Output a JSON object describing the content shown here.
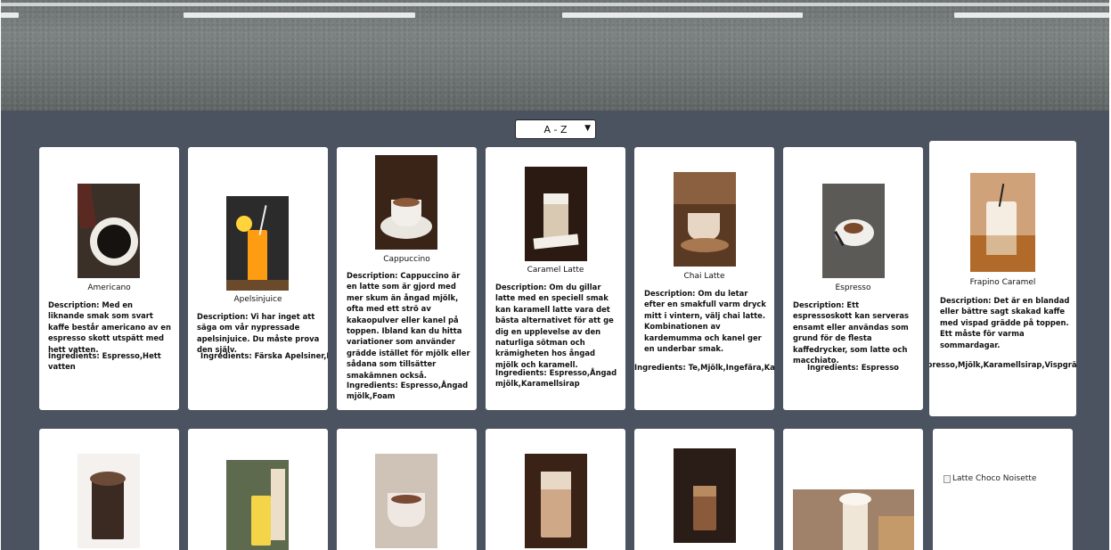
{
  "sort": {
    "selected": "A - Z"
  },
  "products_row1": [
    {
      "name": "Americano",
      "description": "Description: Med en liknande smak som svart kaffe består americano av en espresso skott utspätt med hett vatten.",
      "ingredients": "Ingredients: Espresso,Hett vatten",
      "photo_colors": [
        "#3b3028",
        "#efece6",
        "#151210"
      ]
    },
    {
      "name": "Apelsinjuice",
      "description": "Description: Vi har inget att säga om vår nypressade apelsinjuice. Du måste prova den själv.",
      "ingredients": "Ingredients: Färska Apelsiner,Is",
      "photo_colors": [
        "#2b2b2b",
        "#ff9d12",
        "#ffd43b"
      ]
    },
    {
      "name": "Cappuccino",
      "description": "Description: Cappuccino är en latte som är gjord med mer skum än ångad mjölk, ofta med ett strö av kakaopulver eller kanel på toppen. Ibland kan du hitta variationer som använder grädde istället för mjölk eller sådana som tillsätter smakämnen också.",
      "ingredients": "Ingredients: Espresso,Ångad mjölk,Foam",
      "photo_colors": [
        "#3a2418",
        "#1f1410",
        "#e9e6df"
      ]
    },
    {
      "name": "Caramel Latte",
      "description": "Description: Om du gillar latte med en speciell smak kan karamell latte vara det bästa alternativet för att ge dig en upplevelse av den naturliga sötman och krämigheten hos ångad mjölk och karamell.",
      "ingredients": "Ingredients: Espresso,Ångad mjölk,Karamellsirap",
      "photo_colors": [
        "#2a1a12",
        "#d9c9b3",
        "#f2eee8"
      ]
    },
    {
      "name": "Chai Latte",
      "description": "Description: Om du letar efter en smakfull varm dryck mitt i vintern, välj chai latte. Kombinationen av kardemumma och kanel ger en underbar smak.",
      "ingredients": "Ingredients: Te,Mjölk,Ingefära,Kardemumma,Kanel",
      "photo_colors": [
        "#5a3a22",
        "#e8d6c4",
        "#a87850"
      ]
    },
    {
      "name": "Espresso",
      "description": "Description: Ett espressoskott kan serveras ensamt eller användas som grund för de flesta kaffedrycker, som latte och macchiato.",
      "ingredients": "Ingredients: Espresso",
      "photo_colors": [
        "#5c5a57",
        "#f1efec",
        "#7a4a2a"
      ]
    },
    {
      "name": "Frapino Caramel",
      "description": "Description: Det är en blandad eller bättre sagt skakad kaffe med vispad grädde på toppen. Ett måste för varma sommardagar.",
      "ingredients": "Ingredients: Espresso,Mjölk,Karamellsirap,Vispgrädde*,Karamell",
      "photo_colors": [
        "#d0a27a",
        "#f6ede2",
        "#b26a2a"
      ]
    }
  ],
  "products_row2": [
    {
      "photo_colors": [
        "#3a2a22",
        "#6b4a38",
        "#f4f1ee"
      ]
    },
    {
      "photo_colors": [
        "#5e6a4e",
        "#f4d54a",
        "#ecdfc9"
      ]
    },
    {
      "photo_colors": [
        "#cfc3b8",
        "#7a4a34",
        "#efe8e2"
      ]
    },
    {
      "photo_colors": [
        "#3a2216",
        "#cfa888",
        "#e8d8c6"
      ]
    },
    {
      "photo_colors": [
        "#2a1c16",
        "#8a5a3a",
        "#b88a60"
      ]
    },
    {
      "photo_colors": [
        "#a0826a",
        "#efe6d8",
        "#c59a6a"
      ]
    },
    {
      "broken_image_alt": "Latte Choco Noisette"
    }
  ]
}
